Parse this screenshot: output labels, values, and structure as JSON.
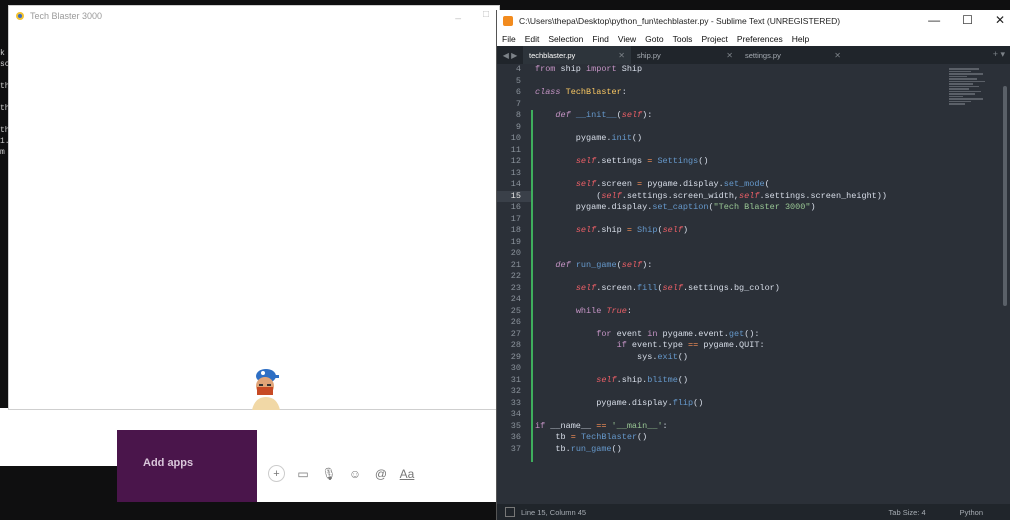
{
  "background": {
    "slack": {
      "add_apps_label": "Add apps",
      "toolbar_icons": [
        "plus-icon",
        "video-icon",
        "mic-icon",
        "emoji-icon",
        "mention-icon",
        "format-icon"
      ],
      "format_label": "Aa"
    },
    "terminal_fragments": "k\nsc\n\nth\n\nth\n\nth\n1.\nm"
  },
  "pygame_window": {
    "title": "Tech Blaster 3000",
    "controls": [
      "_",
      "□"
    ]
  },
  "sublime": {
    "title": "C:\\Users\\thepa\\Desktop\\python_fun\\techblaster.py - Sublime Text (UNREGISTERED)",
    "window_controls": [
      "—",
      "☐",
      "✕"
    ],
    "menu": [
      "File",
      "Edit",
      "Selection",
      "Find",
      "View",
      "Goto",
      "Tools",
      "Project",
      "Preferences",
      "Help"
    ],
    "tabs": [
      {
        "label": "techblaster.py",
        "active": true
      },
      {
        "label": "ship.py",
        "active": false
      },
      {
        "label": "settings.py",
        "active": false
      }
    ],
    "tab_right": "+ ▾",
    "line_numbers": [
      "4",
      "5",
      "6",
      "7",
      "8",
      "9",
      "10",
      "11",
      "12",
      "13",
      "14",
      "15",
      "16",
      "17",
      "18",
      "19",
      "20",
      "21",
      "22",
      "23",
      "24",
      "25",
      "26",
      "27",
      "28",
      "29",
      "30",
      "31",
      "32",
      "33",
      "34",
      "35",
      "36",
      "37"
    ],
    "current_line": "15",
    "status": {
      "position": "Line 15, Column 45",
      "tab_size": "Tab Size: 4",
      "syntax": "Python"
    }
  },
  "colors": {
    "editor_bg": "#2b3038",
    "keyword": "#c594c5",
    "function": "#6699cc",
    "self": "#ec5f67",
    "string": "#99c794",
    "class": "#fac863",
    "git_gutter": "#3fae5d"
  }
}
